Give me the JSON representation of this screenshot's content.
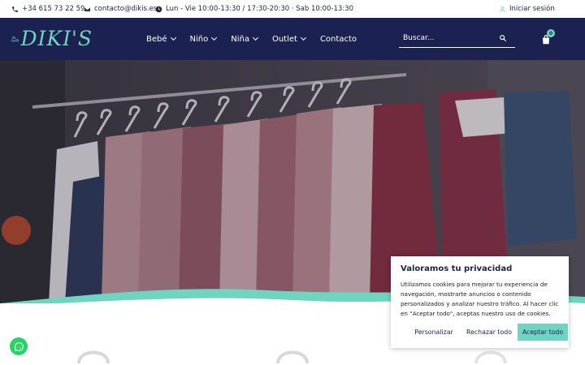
{
  "topbar": {
    "phone": "+34 615 73 22 59",
    "email": "contacto@dikis.es",
    "hours": "Lun - Vie 10:00-13:30 / 17:30-20:30 · Sab 10:00-13:30",
    "login": "Iniciar sesión",
    "icons": [
      "phone-icon",
      "mail-icon",
      "clock-icon",
      "user-icon"
    ]
  },
  "header": {
    "logo_text": "DIKI'S",
    "nav": [
      {
        "label": "Bebé",
        "has_dropdown": true
      },
      {
        "label": "Niño",
        "has_dropdown": true
      },
      {
        "label": "Niña",
        "has_dropdown": true
      },
      {
        "label": "Outlet",
        "has_dropdown": true
      },
      {
        "label": "Contacto",
        "has_dropdown": false
      }
    ],
    "search_placeholder": "Buscar...",
    "cart_count": "0"
  },
  "cookie": {
    "title": "Valoramos tu privacidad",
    "text": "Utilizamos cookies para mejorar tu experiencia de navegación, mostrarte anuncios o contenido personalizados y analizar nuestro tráfico. Al hacer clic en \"Aceptar todo\", aceptas nuestro uso de cookies.",
    "btn_customize": "Personalizar",
    "btn_reject": "Rechazar todo",
    "btn_accept": "Aceptar todo"
  },
  "colors": {
    "navy": "#1b2150",
    "mint": "#6fd4c0",
    "whatsapp": "#25d366"
  }
}
